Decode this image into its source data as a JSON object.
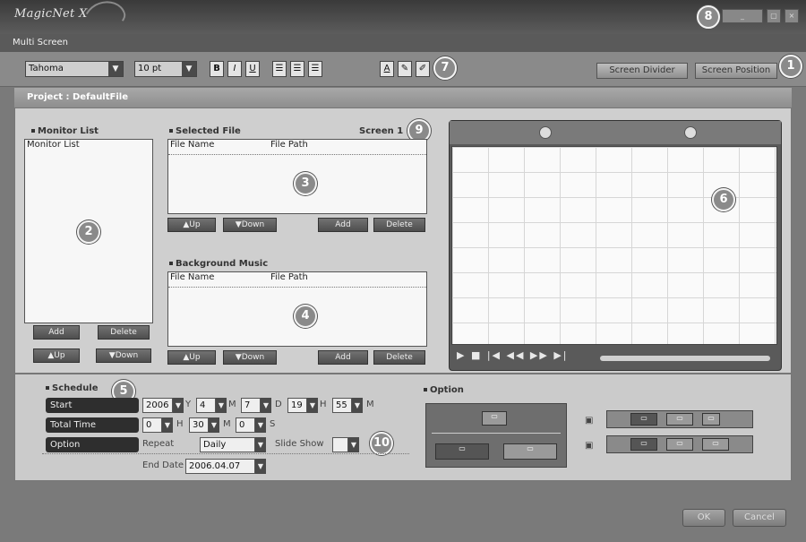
{
  "window": {
    "app_name": "MagicNet X",
    "subtitle": "Multi Screen",
    "controls": [
      "_",
      "▢",
      "×"
    ]
  },
  "toolbar": {
    "font": "Tahoma",
    "size": "10 pt",
    "bold": "B",
    "italic": "I",
    "underline": "U",
    "align_icons": [
      "align-left-icon",
      "align-center-icon",
      "align-right-icon"
    ],
    "color_icons": [
      "font-color-icon",
      "fill-color-icon",
      "line-color-icon"
    ],
    "screen_divide": "Screen Divider",
    "screen_position": "Screen Position"
  },
  "project": {
    "label": "Project : DefaultFile"
  },
  "monitor_list": {
    "title": "Monitor List",
    "header": "Monitor List",
    "add": "Add",
    "delete": "Delete",
    "up": "▲Up",
    "down": "▼Down"
  },
  "selected_file": {
    "title": "Selected File",
    "screen": "Screen 1",
    "col_name": "File Name",
    "col_path": "File Path",
    "up": "▲Up",
    "down": "▼Down",
    "add": "Add",
    "delete": "Delete"
  },
  "background_music": {
    "title": "Background Music",
    "col_name": "File Name",
    "col_path": "File Path",
    "up": "▲Up",
    "down": "▼Down",
    "add": "Add",
    "delete": "Delete"
  },
  "preview": {
    "controls": "▶ ■ |◀ ◀◀ ▶▶ ▶|"
  },
  "schedule": {
    "title": "Schedule",
    "start_label": "Start",
    "start": {
      "year": "2006",
      "year_unit": "Y",
      "month": "4",
      "month_unit": "M",
      "day": "7",
      "day_unit": "D",
      "hour": "19",
      "hour_unit": "H",
      "minute": "55",
      "minute_unit": "M"
    },
    "total_label": "Total Time",
    "total": {
      "h": "0",
      "h_unit": "H",
      "m": "30",
      "m_unit": "M",
      "s": "0",
      "s_unit": "S"
    },
    "option_label": "Option",
    "repeat_label": "Repeat",
    "repeat_value": "Daily",
    "slide_label": "Slide Show",
    "slide_value": "",
    "end_label": "End Date",
    "end_value": "2006.04.07"
  },
  "option": {
    "title": "Option"
  },
  "dialog": {
    "ok": "OK",
    "cancel": "Cancel"
  },
  "badges": [
    "1",
    "2",
    "3",
    "4",
    "5",
    "6",
    "7",
    "8",
    "9",
    "10"
  ]
}
